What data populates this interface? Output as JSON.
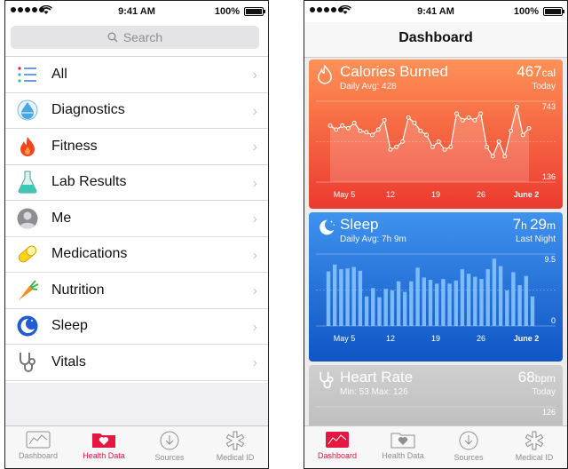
{
  "status": {
    "time": "9:41 AM",
    "battery": "100%"
  },
  "left": {
    "search_placeholder": "Search",
    "categories": [
      {
        "label": "All",
        "icon": "list-icon"
      },
      {
        "label": "Diagnostics",
        "icon": "droplet-icon"
      },
      {
        "label": "Fitness",
        "icon": "flame-icon"
      },
      {
        "label": "Lab Results",
        "icon": "flask-icon"
      },
      {
        "label": "Me",
        "icon": "person-icon"
      },
      {
        "label": "Medications",
        "icon": "pill-icon"
      },
      {
        "label": "Nutrition",
        "icon": "carrot-icon"
      },
      {
        "label": "Sleep",
        "icon": "moon-icon"
      },
      {
        "label": "Vitals",
        "icon": "stethoscope-icon"
      }
    ],
    "active_tab": "Health Data"
  },
  "right": {
    "nav_title": "Dashboard",
    "active_tab": "Dashboard",
    "calories": {
      "title": "Calories Burned",
      "subtitle": "Daily Avg: 428",
      "value": "467",
      "unit": "cal",
      "period": "Today",
      "ymax_label": "743",
      "ymin_label": "136",
      "color": "#ff5a36"
    },
    "sleep": {
      "title": "Sleep",
      "subtitle": "Daily Avg: 7h 9m",
      "value_h": "7",
      "value_m": "29",
      "period": "Last Night",
      "ymax_label": "9.5",
      "ymin_label": "0",
      "color": "#2a7ae8"
    },
    "heart": {
      "title": "Heart Rate",
      "subtitle": "Min: 53 Max: 126",
      "value": "68",
      "unit": "bpm",
      "period": "Today",
      "ymax_label": "126",
      "color": "#c8c8c8"
    },
    "x_labels": [
      "May 5",
      "12",
      "19",
      "26",
      "June 2"
    ]
  },
  "tabs": [
    {
      "label": "Dashboard",
      "icon": "dashboard-icon"
    },
    {
      "label": "Health Data",
      "icon": "health-data-icon"
    },
    {
      "label": "Sources",
      "icon": "sources-icon"
    },
    {
      "label": "Medical ID",
      "icon": "medical-id-icon"
    }
  ],
  "chart_data": [
    {
      "type": "line",
      "title": "Calories Burned",
      "ylim": [
        136,
        743
      ],
      "x_ticks": [
        "May 5",
        "12",
        "19",
        "26",
        "June 2"
      ],
      "values": [
        560,
        530,
        560,
        540,
        580,
        520,
        510,
        490,
        530,
        600,
        380,
        400,
        440,
        620,
        580,
        520,
        490,
        400,
        440,
        380,
        400,
        650,
        600,
        620,
        600,
        650,
        400,
        330,
        440,
        330,
        520,
        700,
        490,
        540
      ]
    },
    {
      "type": "bar",
      "title": "Sleep",
      "ylim": [
        0,
        9.5
      ],
      "x_ticks": [
        "May 5",
        "12",
        "19",
        "26",
        "June 2"
      ],
      "values": [
        7.2,
        8.1,
        7.5,
        7.6,
        7.8,
        7.3,
        3.9,
        5.0,
        3.8,
        4.9,
        4.7,
        5.9,
        4.5,
        5.9,
        7.7,
        6.4,
        6.1,
        5.6,
        6.2,
        5.6,
        6.0,
        7.5,
        6.9,
        6.5,
        6.2,
        7.5,
        8.9,
        7.9,
        4.7,
        7.1,
        5.4,
        6.6,
        3.9
      ]
    },
    {
      "type": "scatter",
      "title": "Heart Rate",
      "ylim": [
        53,
        126
      ],
      "x_ticks": [],
      "values": []
    }
  ]
}
